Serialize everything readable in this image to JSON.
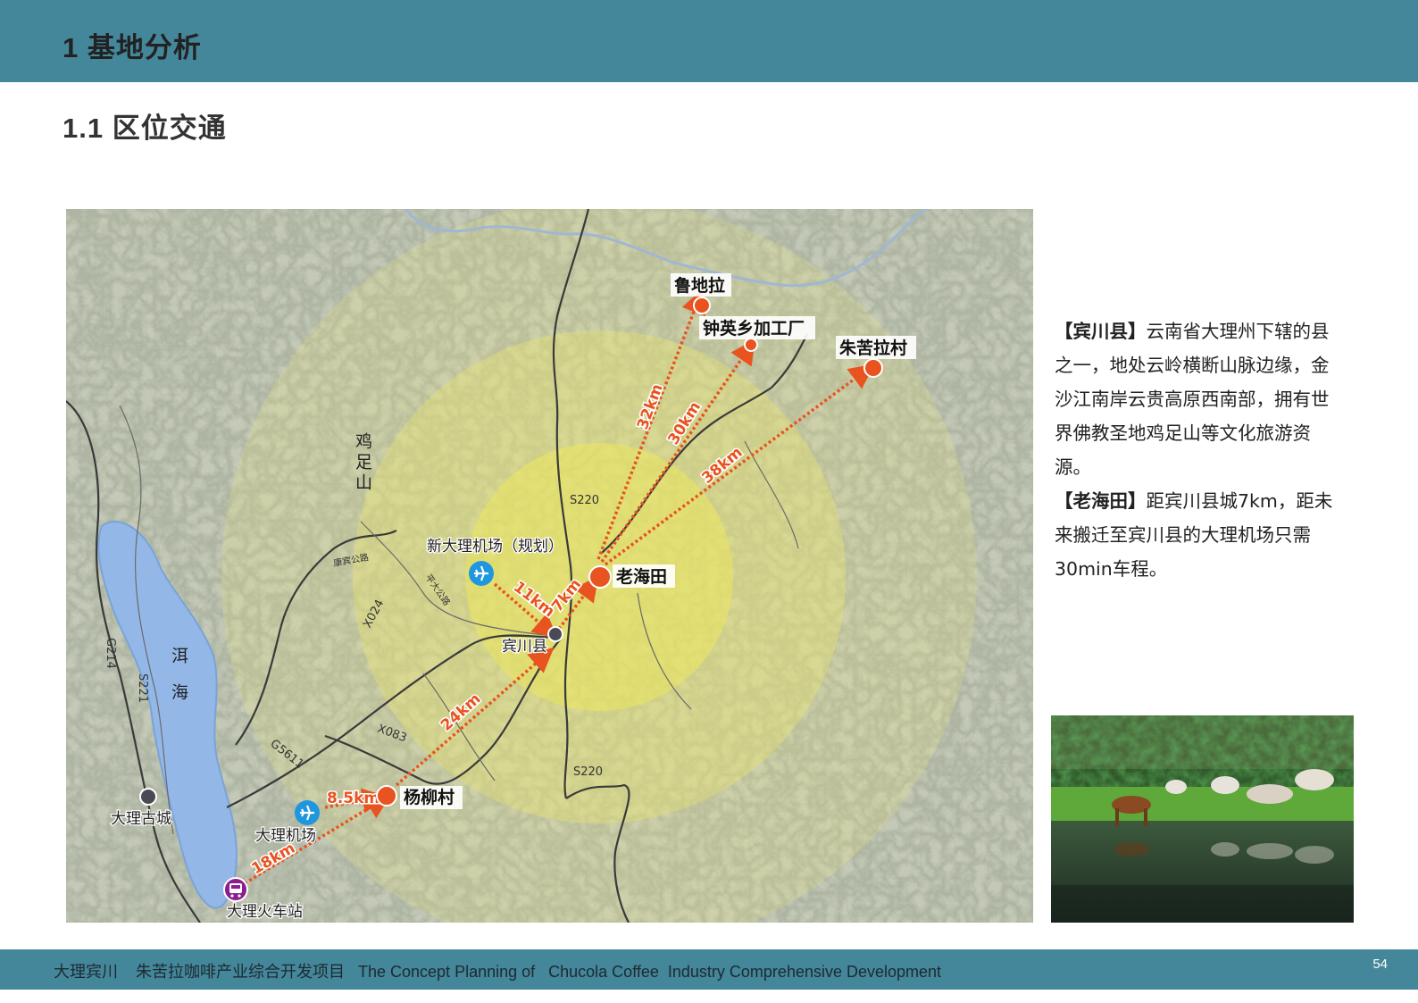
{
  "header": {
    "title": "1  基地分析"
  },
  "section": {
    "title": "1.1  区位交通"
  },
  "map": {
    "places": {
      "ludila": "鲁地拉",
      "zhongying": "钟英乡加工厂",
      "zhukula": "朱苦拉村",
      "laohaitian": "老海田",
      "binchuan": "宾川县",
      "new_airport": "新大理机场（规划）",
      "yangliu": "杨柳村",
      "dali_airport": "大理机场",
      "dali_station": "大理火车站",
      "dali_oldtown": "大理古城",
      "jizushan": "鸡足山",
      "erhai": "洱海"
    },
    "roads": {
      "s220_top": "S220",
      "s220_bottom": "S220",
      "x024": "X024",
      "x083": "X083",
      "g5611": "G5611",
      "g214": "G214",
      "s221": "S221",
      "road_a": "康宾公路",
      "road_b": "平大公路"
    },
    "distances": {
      "d32": "32km",
      "d30": "30km",
      "d38": "38km",
      "d11": "11km",
      "d7": "7km",
      "d24": "24km",
      "d85": "8.5km",
      "d18": "18km"
    },
    "colors": {
      "accent": "#e8531f",
      "label_box": "#ffffff",
      "ring": "#f0ea6a",
      "lake": "#93b8e8",
      "airport": "#1f97de",
      "station": "#8b1e8f"
    },
    "icons": [
      "airplane-icon",
      "airplane-icon",
      "train-icon"
    ]
  },
  "description": {
    "p1_head": "【宾川县】",
    "p1_line1": "云南省大理州下辖的县",
    "p1_line2": "之一，地处云岭横断山脉边缘，金",
    "p1_line3": "沙江南岸云贵高原西南部，拥有世",
    "p1_line4": "界佛教圣地鸡足山等文化旅游资",
    "p1_line5": "源。",
    "p2_head": "【老海田】",
    "p2_line1": "距宾川县城7km，距未",
    "p2_line2": "来搬迁至宾川县的大理机场只需",
    "p2_line3": "30min车程。"
  },
  "footer": {
    "text": "大理宾川    朱苦拉咖啡产业综合开发项目   The Concept Planning of   Chucola Coffee  Industry Comprehensive Development",
    "page": "54"
  }
}
